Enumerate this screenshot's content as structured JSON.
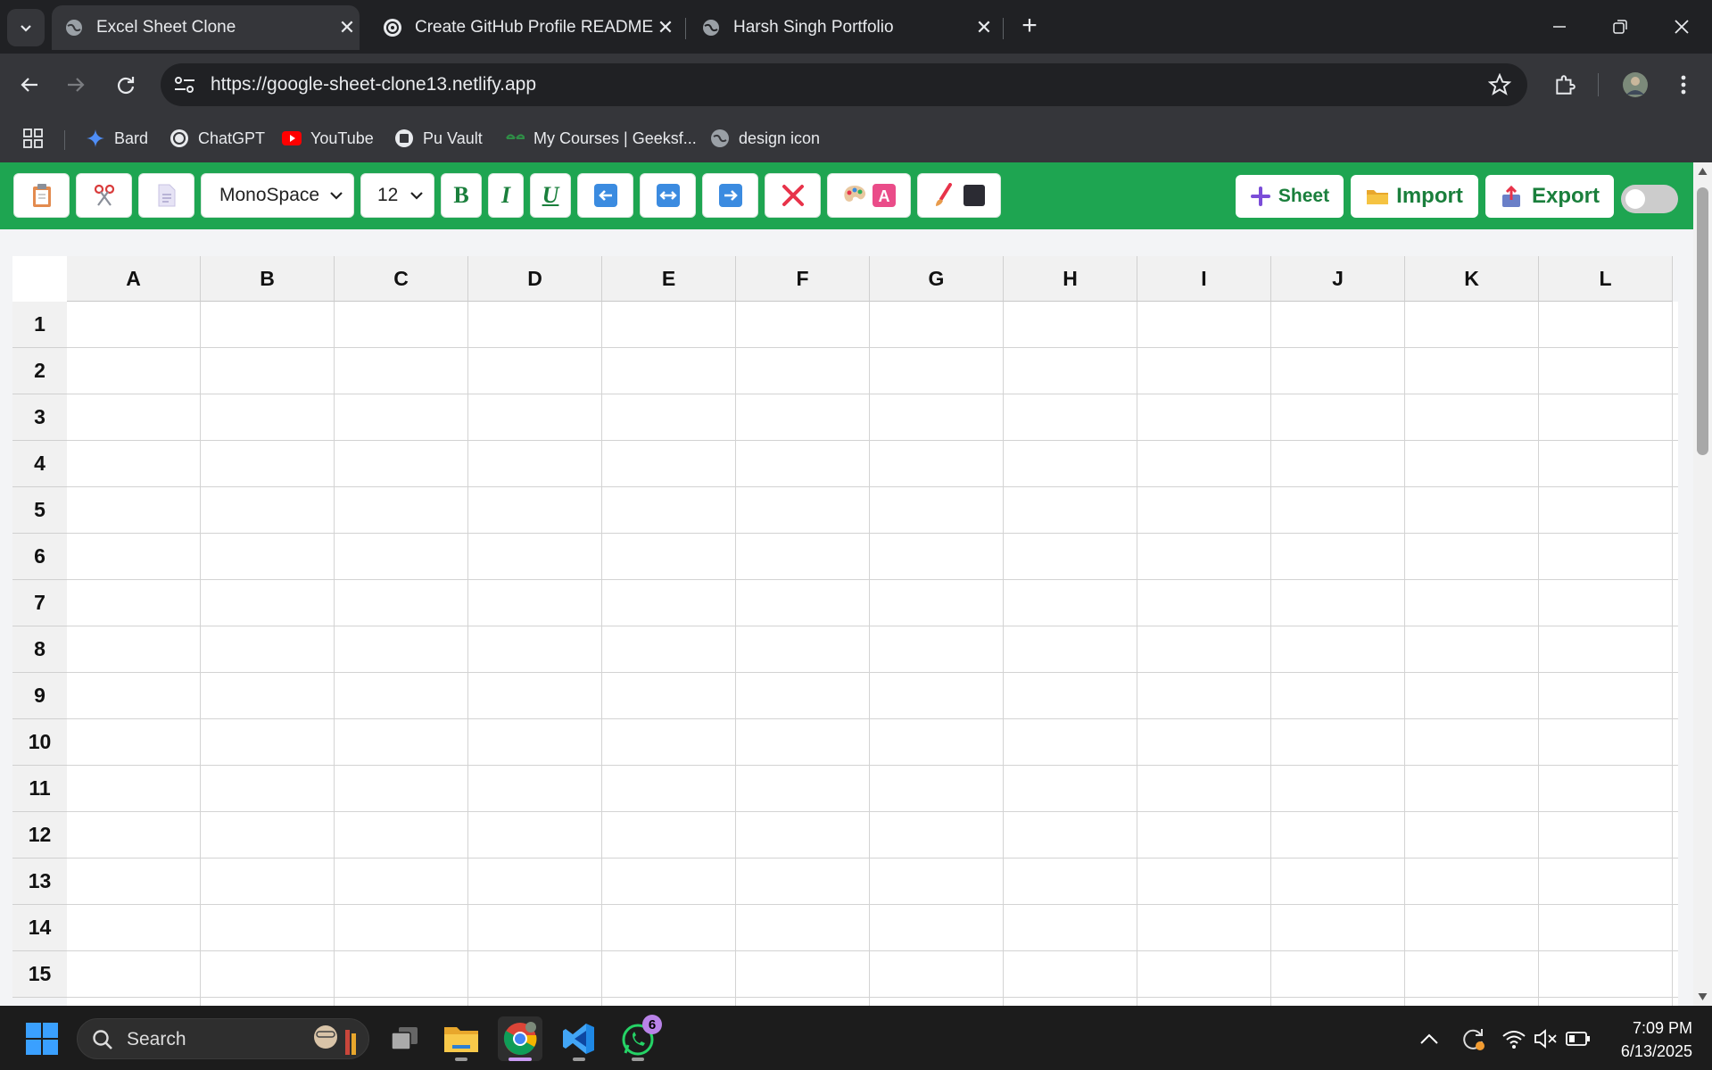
{
  "browser": {
    "tabs": [
      {
        "title": "Excel Sheet Clone",
        "active": true
      },
      {
        "title": "Create GitHub Profile README",
        "active": false
      },
      {
        "title": "Harsh Singh Portfolio",
        "active": false
      }
    ],
    "url": "https://google-sheet-clone13.netlify.app",
    "bookmarks": [
      "Bard",
      "ChatGPT",
      "YouTube",
      "Pu Vault",
      "My Courses | Geeksf...",
      "design icon"
    ]
  },
  "toolbar": {
    "font_family": "MonoSpace",
    "font_size": "12",
    "bold_label": "B",
    "italic_label": "I",
    "underline_label": "U",
    "sheet_label": "Sheet",
    "import_label": "Import",
    "export_label": "Export",
    "accent_color": "#1ea551"
  },
  "sheet": {
    "columns": [
      "A",
      "B",
      "C",
      "D",
      "E",
      "F",
      "G",
      "H",
      "I",
      "J",
      "K",
      "L"
    ],
    "rows": [
      "1",
      "2",
      "3",
      "4",
      "5",
      "6",
      "7",
      "8",
      "9",
      "10",
      "11",
      "12",
      "13",
      "14",
      "15"
    ]
  },
  "taskbar": {
    "search_label": "Search",
    "whatsapp_badge": "6",
    "time": "7:09 PM",
    "date": "6/13/2025"
  }
}
